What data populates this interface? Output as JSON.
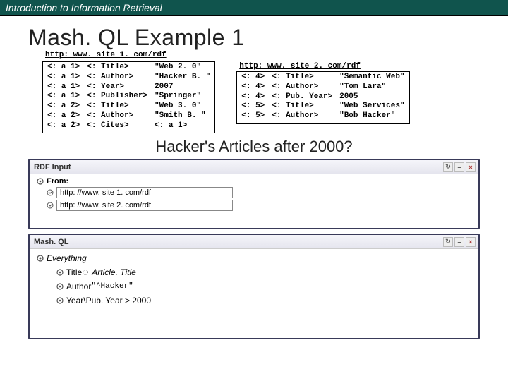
{
  "header": {
    "breadcrumb": "Introduction to Information Retrieval"
  },
  "title": "Mash. QL Example 1",
  "rdf1": {
    "url": "http: www. site 1. com/rdf",
    "rows": [
      [
        "<: a 1>",
        "<: Title>",
        "\"Web 2. 0\""
      ],
      [
        "<: a 1>",
        "<: Author>",
        "\"Hacker B. \""
      ],
      [
        "<: a 1>",
        "<: Year>",
        "2007"
      ],
      [
        "<: a 1>",
        "<: Publisher>",
        "\"Springer\""
      ],
      [
        "<: a 2>",
        "<: Title>",
        "\"Web 3. 0\""
      ],
      [
        "<: a 2>",
        "<: Author>",
        "\"Smith B. \""
      ],
      [
        "<: a 2>",
        "<: Cites>",
        "<: a 1>"
      ]
    ]
  },
  "rdf2": {
    "url": "http: www. site 2. com/rdf",
    "rows": [
      [
        "<: 4>",
        "<: Title>",
        "\"Semantic Web\""
      ],
      [
        "<: 4>",
        "<: Author>",
        "\"Tom Lara\""
      ],
      [
        "<: 4>",
        "<: Pub. Year>",
        "2005"
      ],
      [
        "<: 5>",
        "<: Title>",
        "\"Web Services\""
      ],
      [
        "<: 5>",
        "<: Author>",
        "\"Bob Hacker\""
      ]
    ]
  },
  "question": "Hacker's Articles after 2000?",
  "rdf_panel": {
    "title": "RDF Input",
    "from": "From:",
    "inputs": [
      "http: //www. site 1. com/rdf",
      "http: //www. site 2. com/rdf"
    ]
  },
  "mash_panel": {
    "title": "Mash. QL",
    "root": "Everything",
    "children": [
      {
        "label": "Title",
        "suffix": "Article. Title",
        "gear": true
      },
      {
        "label": "Author",
        "suffix": "\"^Hacker\"",
        "gear": false,
        "mono": true
      },
      {
        "label": "",
        "suffix": "Year\\Pub. Year > 2000",
        "gear": false,
        "plain": true
      }
    ]
  }
}
